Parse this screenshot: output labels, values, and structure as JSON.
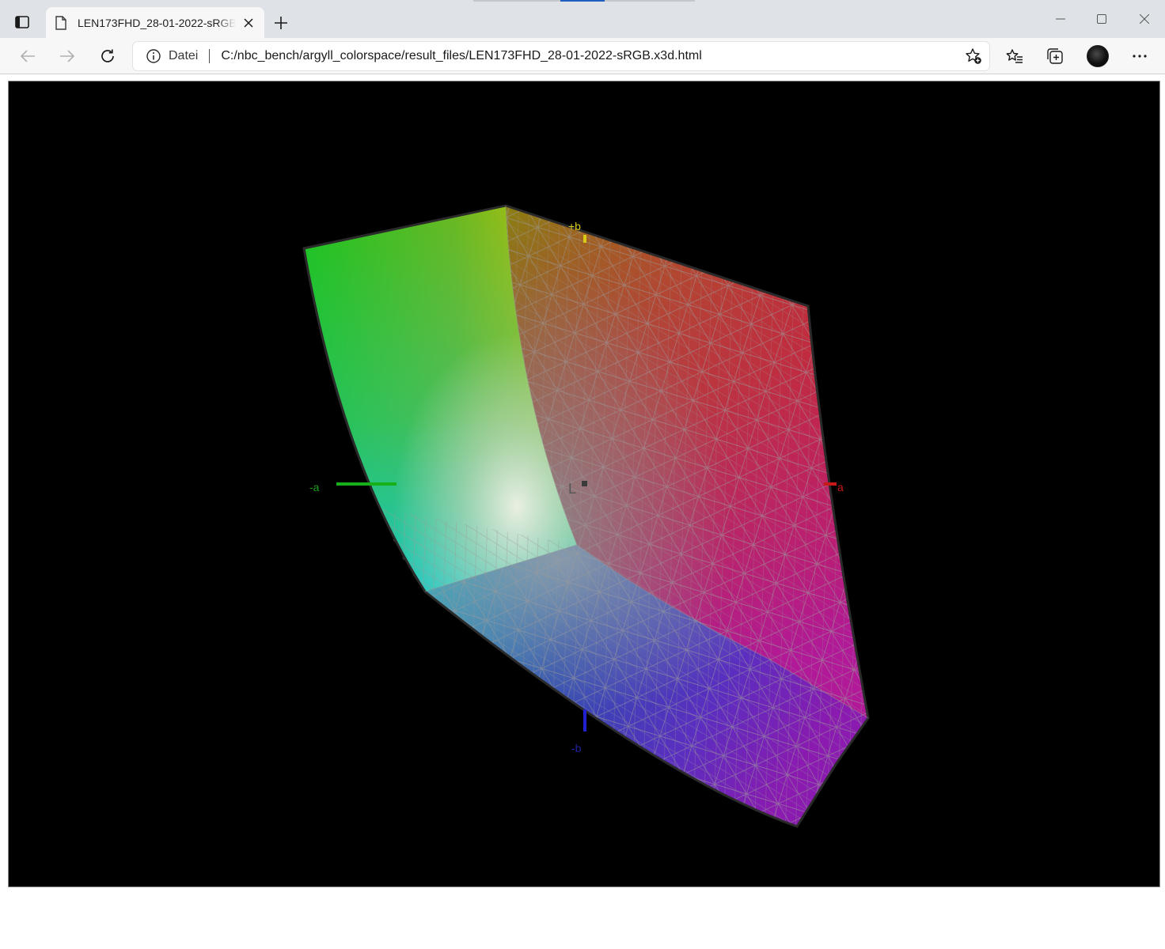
{
  "browser": {
    "tab": {
      "title": "LEN173FHD_28-01-2022-sRGB.x3d.html"
    },
    "address_bar": {
      "scheme_label": "Datei",
      "url": "C:/nbc_bench/argyll_colorspace/result_files/LEN173FHD_28-01-2022-sRGB.x3d.html"
    },
    "icons": {
      "tab_actions": "tab-actions-icon",
      "page": "page-icon",
      "close_tab": "close-icon",
      "new_tab": "plus-icon",
      "minimize": "minimize-icon",
      "maximize": "maximize-icon",
      "close_window": "close-icon",
      "back": "arrow-left-icon",
      "forward": "arrow-right-icon",
      "refresh": "refresh-icon",
      "info": "info-icon",
      "add_favorite": "star-plus-icon",
      "favorites": "favorites-icon",
      "collections": "collections-icon",
      "profile": "avatar",
      "menu": "more-icon"
    }
  },
  "viewer": {
    "axis_labels": {
      "plus_b": "+b",
      "minus_b": "-b",
      "minus_a": "-a",
      "plus_a": "a",
      "lightness": "L"
    },
    "colors": {
      "background": "#000000",
      "green": "#1fc21a",
      "yellow": "#c9c20a",
      "red": "#c8281c",
      "magenta": "#b0189e",
      "blue": "#2a3ab0",
      "violet": "#6a28c8",
      "cyan": "#17c8c8",
      "white_point": "#e8e8e8",
      "mesh": "#9a9a9a"
    }
  }
}
